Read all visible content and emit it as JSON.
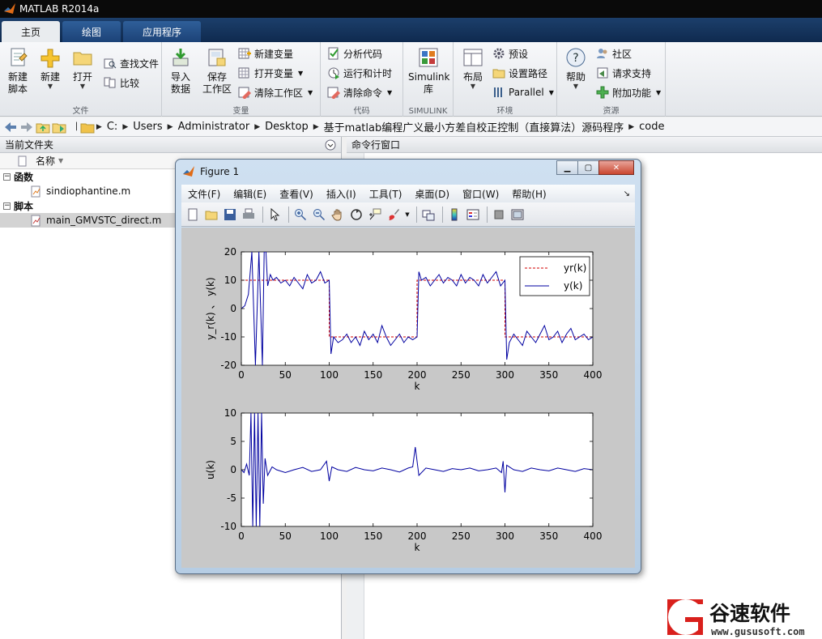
{
  "app": {
    "title": "MATLAB R2014a"
  },
  "tabs": [
    {
      "label": "主页",
      "active": true
    },
    {
      "label": "绘图",
      "active": false
    },
    {
      "label": "应用程序",
      "active": false
    }
  ],
  "ribbon": {
    "file": {
      "group_label": "文件",
      "new_script": "新建\n脚本",
      "new": "新建",
      "open": "打开",
      "find_files": "查找文件",
      "compare": "比较"
    },
    "variable": {
      "group_label": "变量",
      "import": "导入\n数据",
      "save": "保存\n工作区",
      "new_var": "新建变量",
      "open_var": "打开变量",
      "clear_ws": "清除工作区"
    },
    "code": {
      "group_label": "代码",
      "analyze": "分析代码",
      "run_time": "运行和计时",
      "clear_cmd": "清除命令"
    },
    "simulink": {
      "group_label": "SIMULINK",
      "library": "Simulink\n库"
    },
    "env": {
      "group_label": "环境",
      "layout": "布局",
      "prefs": "预设",
      "set_path": "设置路径",
      "parallel": "Parallel"
    },
    "resources": {
      "group_label": "资源",
      "help": "帮助",
      "community": "社区",
      "support": "请求支持",
      "addons": "附加功能"
    }
  },
  "address": {
    "crumbs": [
      "C:",
      "Users",
      "Administrator",
      "Desktop",
      "基于matlab编程广义最小方差自校正控制（直接算法）源码程序",
      "code"
    ]
  },
  "current_folder": {
    "title": "当前文件夹",
    "column": "名称",
    "sections": [
      {
        "label": "函数",
        "files": [
          {
            "name": "sindiophantine.m",
            "selected": false
          }
        ]
      },
      {
        "label": "脚本",
        "files": [
          {
            "name": "main_GMVSTC_direct.m",
            "selected": true
          }
        ]
      }
    ]
  },
  "command_window": {
    "title": "命令行窗口"
  },
  "figure": {
    "title": "Figure 1",
    "menu": [
      "文件(F)",
      "编辑(E)",
      "查看(V)",
      "插入(I)",
      "工具(T)",
      "桌面(D)",
      "窗口(W)",
      "帮助(H)"
    ]
  },
  "chart_data": [
    {
      "type": "line",
      "xlabel": "k",
      "ylabel": "y_r(k) 、 y(k)",
      "xlim": [
        0,
        400
      ],
      "ylim": [
        -20,
        20
      ],
      "xticks": [
        0,
        50,
        100,
        150,
        200,
        250,
        300,
        350,
        400
      ],
      "yticks": [
        -20,
        -10,
        0,
        10,
        20
      ],
      "legend": {
        "position": "top-right",
        "entries": [
          "yr(k)",
          "y(k)"
        ]
      },
      "series": [
        {
          "name": "yr(k)",
          "color": "#d00000",
          "style": "dashed",
          "x": [
            0,
            100,
            100,
            200,
            200,
            300,
            300,
            400
          ],
          "y": [
            10,
            10,
            -10,
            -10,
            10,
            10,
            -10,
            -10
          ]
        },
        {
          "name": "y(k)",
          "color": "#0000a0",
          "style": "solid",
          "x": [
            0,
            4,
            8,
            12,
            16,
            20,
            24,
            26,
            28,
            30,
            33,
            36,
            40,
            45,
            50,
            55,
            60,
            65,
            70,
            75,
            80,
            85,
            90,
            95,
            100,
            102,
            105,
            110,
            115,
            120,
            125,
            130,
            135,
            140,
            145,
            150,
            155,
            160,
            165,
            170,
            175,
            180,
            185,
            190,
            195,
            200,
            202,
            205,
            210,
            215,
            220,
            225,
            230,
            235,
            240,
            245,
            250,
            255,
            260,
            265,
            270,
            275,
            280,
            285,
            290,
            295,
            300,
            302,
            305,
            310,
            315,
            320,
            325,
            330,
            335,
            340,
            345,
            350,
            355,
            360,
            365,
            370,
            375,
            380,
            385,
            390,
            395,
            400
          ],
          "y": [
            0,
            1,
            5,
            20,
            -20,
            20,
            -20,
            20,
            20,
            8,
            12,
            10,
            11,
            9,
            10,
            8,
            11,
            9,
            7,
            12,
            9,
            10,
            13,
            9,
            10,
            -16,
            -10,
            -12,
            -11,
            -9,
            -12,
            -10,
            -13,
            -8,
            -11,
            -9,
            -12,
            -6,
            -10,
            -13,
            -11,
            -9,
            -12,
            -10,
            -11,
            -10,
            13,
            10,
            11,
            8,
            10,
            12,
            9,
            11,
            10,
            8,
            12,
            9,
            11,
            10,
            8,
            12,
            9,
            11,
            13,
            8,
            10,
            -18,
            -12,
            -9,
            -11,
            -13,
            -8,
            -10,
            -12,
            -9,
            -6,
            -11,
            -10,
            -8,
            -12,
            -9,
            -7,
            -11,
            -10,
            -9,
            -11,
            -10
          ]
        }
      ]
    },
    {
      "type": "line",
      "xlabel": "k",
      "ylabel": "u(k)",
      "xlim": [
        0,
        400
      ],
      "ylim": [
        -10,
        10
      ],
      "xticks": [
        0,
        50,
        100,
        150,
        200,
        250,
        300,
        350,
        400
      ],
      "yticks": [
        -10,
        -5,
        0,
        5,
        10
      ],
      "series": [
        {
          "color": "#0000a0",
          "style": "solid",
          "x": [
            0,
            3,
            6,
            9,
            11,
            13,
            15,
            17,
            19,
            21,
            23,
            25,
            27,
            30,
            35,
            40,
            50,
            60,
            70,
            80,
            90,
            97,
            100,
            103,
            110,
            120,
            130,
            140,
            150,
            160,
            170,
            180,
            190,
            195,
            198,
            202,
            210,
            220,
            230,
            240,
            250,
            260,
            270,
            280,
            290,
            296,
            298,
            300,
            302,
            310,
            320,
            330,
            340,
            350,
            360,
            370,
            380,
            390,
            400
          ],
          "y": [
            0,
            -0.5,
            1,
            -1,
            10,
            -10,
            10,
            -10,
            10,
            -10,
            10,
            -6,
            2,
            -1,
            0.5,
            0,
            -0.5,
            0,
            0.4,
            -0.3,
            0,
            1.5,
            -2,
            0.5,
            0,
            -0.3,
            0.4,
            0,
            -0.2,
            0.3,
            0,
            -0.4,
            0.3,
            0.5,
            4,
            -1,
            0.3,
            0,
            -0.3,
            0.2,
            0,
            0.3,
            -0.2,
            0,
            0.3,
            -0.5,
            1.5,
            -4,
            0.8,
            0,
            -0.3,
            0.3,
            0,
            -0.2,
            0.3,
            0,
            -0.3,
            0.2,
            0
          ]
        }
      ]
    }
  ],
  "watermark": {
    "brand": "谷速软件",
    "url": "www.gususoft.com"
  }
}
